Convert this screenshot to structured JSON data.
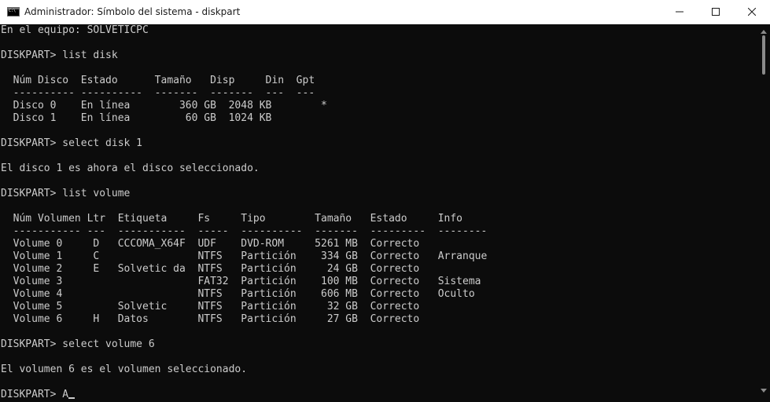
{
  "window": {
    "title": "Administrador: Símbolo del sistema - diskpart",
    "icon": "cmd-icon",
    "controls": [
      "minimize-icon",
      "maximize-icon",
      "close-icon"
    ]
  },
  "terminal": {
    "lines": [
      "En el equipo: SOLVETICPC",
      "",
      "DISKPART> list disk",
      "",
      "  Núm Disco  Estado      Tamaño   Disp     Din  Gpt",
      "  ---------- ----------  -------  -------  ---  ---",
      "  Disco 0    En línea        360 GB  2048 KB        *",
      "  Disco 1    En línea         60 GB  1024 KB",
      "",
      "DISKPART> select disk 1",
      "",
      "El disco 1 es ahora el disco seleccionado.",
      "",
      "DISKPART> list volume",
      "",
      "  Núm Volumen Ltr  Etiqueta     Fs     Tipo        Tamaño   Estado     Info",
      "  ----------- ---  -----------  -----  ----------  -------  ---------  --------",
      "  Volume 0     D   CCCOMA_X64F  UDF    DVD-ROM     5261 MB  Correcto",
      "  Volume 1     C                NTFS   Partición    334 GB  Correcto   Arranque",
      "  Volume 2     E   Solvetic da  NTFS   Partición     24 GB  Correcto",
      "  Volume 3                      FAT32  Partición    100 MB  Correcto   Sistema",
      "  Volume 4                      NTFS   Partición    606 MB  Correcto   Oculto",
      "  Volume 5         Solvetic     NTFS   Partición     32 GB  Correcto",
      "  Volume 6     H   Datos        NTFS   Partición     27 GB  Correcto",
      "",
      "DISKPART> select volume 6",
      "",
      "El volumen 6 es el volumen seleccionado.",
      "",
      "DISKPART> A"
    ]
  }
}
